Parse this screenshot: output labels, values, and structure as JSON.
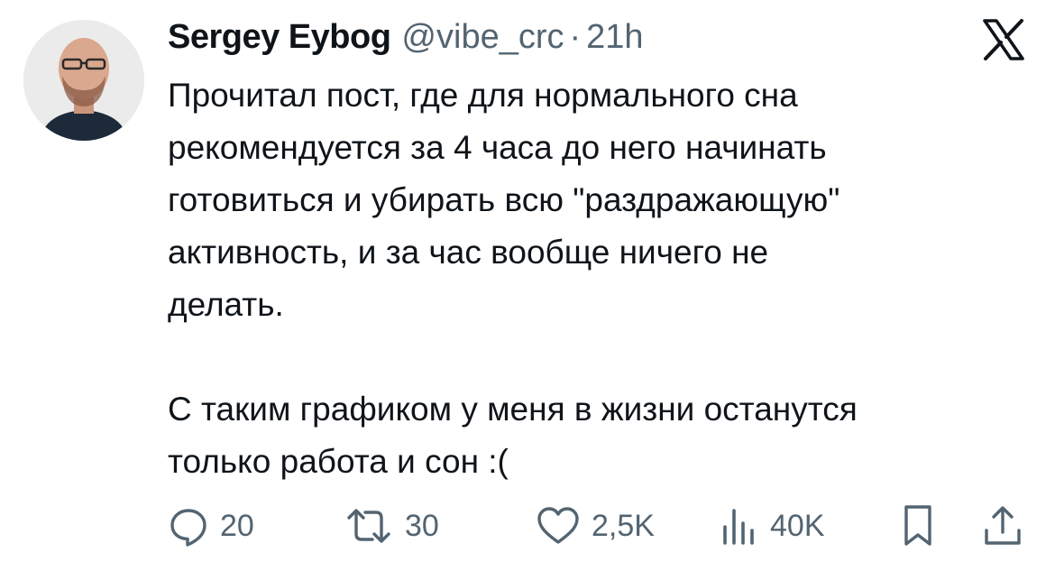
{
  "author": {
    "name": "Sergey Eybog",
    "handle": "@vibe_crc",
    "separator": "·",
    "time": "21h",
    "avatar_icon": "avatar-photo"
  },
  "brand_icon": "x-logo-icon",
  "tweet_text": "Прочитал пост, где для нормального сна\nрекомендуется за 4 часа до него начинать\nготовиться и убирать всю \"раздражающую\"\nактивность, и за час вообще ничего не\nделать.\n\nС таким графиком у меня в жизни останутся\nтолько работа и сон :(",
  "actions": {
    "replies": "20",
    "reposts": "30",
    "likes": "2,5K",
    "views": "40K"
  },
  "colors": {
    "text": "#0f1419",
    "secondary": "#536471",
    "background": "#ffffff"
  }
}
